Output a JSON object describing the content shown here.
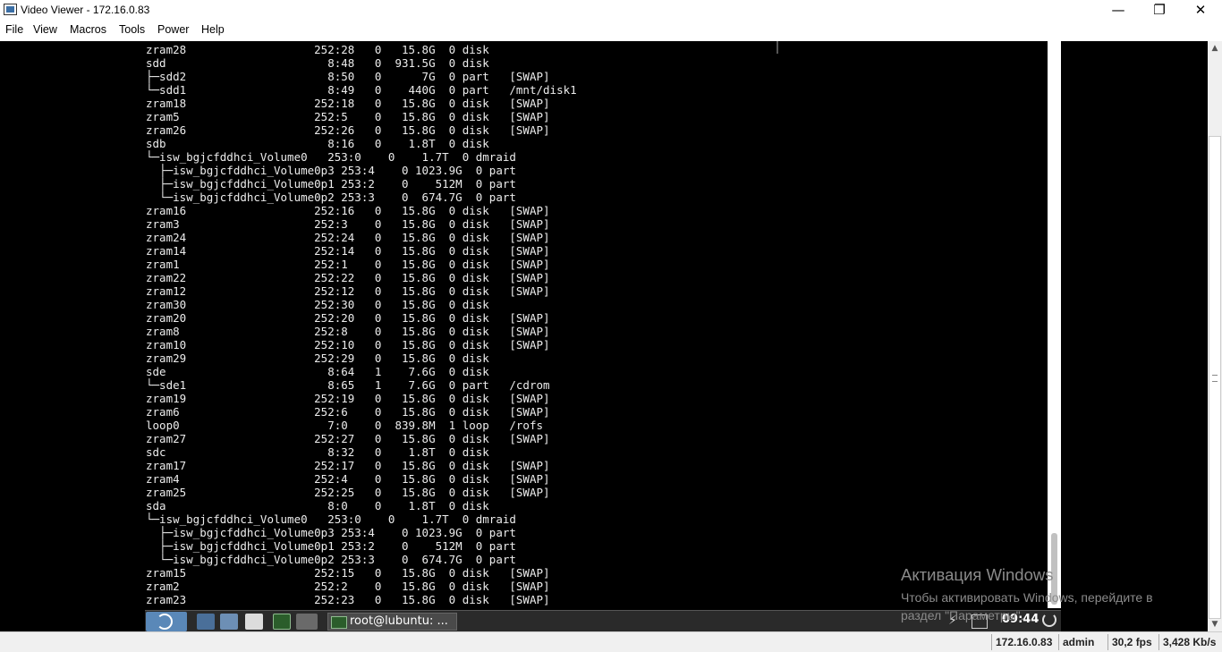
{
  "window": {
    "title": "Video Viewer - 172.16.0.83",
    "minimize_glyph": "—",
    "maximize_glyph": "❐",
    "close_glyph": "✕"
  },
  "menu": [
    "File",
    "View",
    "Macros",
    "Tools",
    "Power",
    "Help"
  ],
  "terminal": {
    "lines": [
      "zram28                   252:28   0   15.8G  0 disk",
      "sdd                        8:48   0  931.5G  0 disk",
      "├─sdd2                     8:50   0      7G  0 part   [SWAP]",
      "└─sdd1                     8:49   0    440G  0 part   /mnt/disk1",
      "zram18                   252:18   0   15.8G  0 disk   [SWAP]",
      "zram5                    252:5    0   15.8G  0 disk   [SWAP]",
      "zram26                   252:26   0   15.8G  0 disk   [SWAP]",
      "sdb                        8:16   0    1.8T  0 disk",
      "└─isw_bgjcfddhci_Volume0   253:0    0    1.7T  0 dmraid",
      "  ├─isw_bgjcfddhci_Volume0p3 253:4    0 1023.9G  0 part",
      "  ├─isw_bgjcfddhci_Volume0p1 253:2    0    512M  0 part",
      "  └─isw_bgjcfddhci_Volume0p2 253:3    0  674.7G  0 part",
      "zram16                   252:16   0   15.8G  0 disk   [SWAP]",
      "zram3                    252:3    0   15.8G  0 disk   [SWAP]",
      "zram24                   252:24   0   15.8G  0 disk   [SWAP]",
      "zram14                   252:14   0   15.8G  0 disk   [SWAP]",
      "zram1                    252:1    0   15.8G  0 disk   [SWAP]",
      "zram22                   252:22   0   15.8G  0 disk   [SWAP]",
      "zram12                   252:12   0   15.8G  0 disk   [SWAP]",
      "zram30                   252:30   0   15.8G  0 disk",
      "zram20                   252:20   0   15.8G  0 disk   [SWAP]",
      "zram8                    252:8    0   15.8G  0 disk   [SWAP]",
      "zram10                   252:10   0   15.8G  0 disk   [SWAP]",
      "zram29                   252:29   0   15.8G  0 disk",
      "sde                        8:64   1    7.6G  0 disk",
      "└─sde1                     8:65   1    7.6G  0 part   /cdrom",
      "zram19                   252:19   0   15.8G  0 disk   [SWAP]",
      "zram6                    252:6    0   15.8G  0 disk   [SWAP]",
      "loop0                      7:0    0  839.8M  1 loop   /rofs",
      "zram27                   252:27   0   15.8G  0 disk   [SWAP]",
      "sdc                        8:32   0    1.8T  0 disk",
      "zram17                   252:17   0   15.8G  0 disk   [SWAP]",
      "zram4                    252:4    0   15.8G  0 disk   [SWAP]",
      "zram25                   252:25   0   15.8G  0 disk   [SWAP]",
      "sda                        8:0    0    1.8T  0 disk",
      "└─isw_bgjcfddhci_Volume0   253:0    0    1.7T  0 dmraid",
      "  ├─isw_bgjcfddhci_Volume0p3 253:4    0 1023.9G  0 part",
      "  ├─isw_bgjcfddhci_Volume0p1 253:2    0    512M  0 part",
      "  └─isw_bgjcfddhci_Volume0p2 253:3    0  674.7G  0 part",
      "zram15                   252:15   0   15.8G  0 disk   [SWAP]",
      "zram2                    252:2    0   15.8G  0 disk   [SWAP]",
      "zram23                   252:23   0   15.8G  0 disk   [SWAP]"
    ]
  },
  "taskbar": {
    "task_label": "root@lubuntu: ...",
    "clock": "09:44",
    "icons": [
      "start-menu-icon",
      "file-manager-icon",
      "network-icon",
      "window-icon",
      "terminal-icon",
      "blank-icon"
    ]
  },
  "activation": {
    "title": "Активация Windows",
    "line1": "Чтобы активировать Windows, перейдите в",
    "line2": "раздел \"Параметры\"."
  },
  "statusbar": {
    "host": "172.16.0.83",
    "user": "admin",
    "fps": "30,2 fps",
    "rate": "3,428 Kb/s"
  },
  "colors": {
    "terminal_bg": "#000000",
    "terminal_fg": "#ececec",
    "taskbar_bg": "#2a2a2a",
    "start_button": "#5a88b8"
  }
}
